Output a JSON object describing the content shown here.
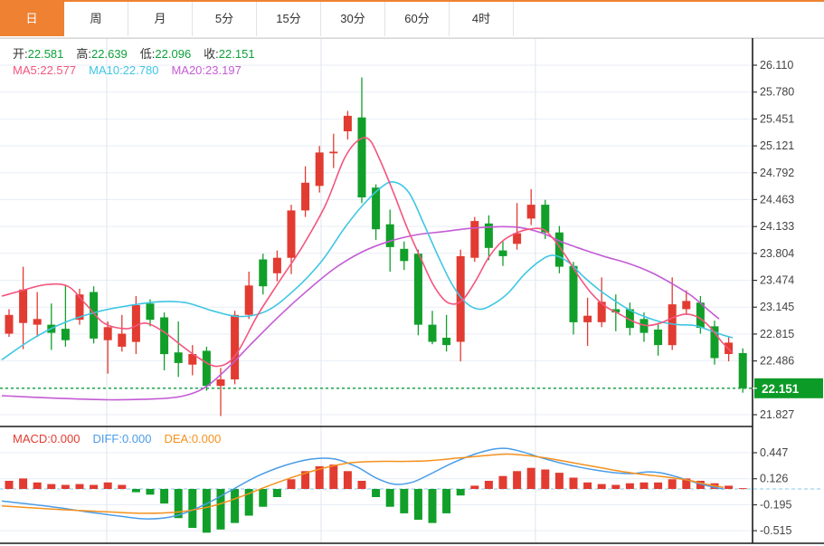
{
  "tabs": {
    "items": [
      {
        "label": "日",
        "selected": true
      },
      {
        "label": "周",
        "selected": false
      },
      {
        "label": "月",
        "selected": false
      },
      {
        "label": "5分",
        "selected": false
      },
      {
        "label": "15分",
        "selected": false
      },
      {
        "label": "30分",
        "selected": false
      },
      {
        "label": "60分",
        "selected": false
      },
      {
        "label": "4时",
        "selected": false
      }
    ]
  },
  "ohlc_bar": {
    "items": [
      {
        "label": "开:",
        "value": "22.581"
      },
      {
        "label": "高:",
        "value": "22.639"
      },
      {
        "label": "低:",
        "value": "22.096"
      },
      {
        "label": "收:",
        "value": "22.151"
      }
    ],
    "value_color": "#0ca13a"
  },
  "ma_bar": {
    "items": [
      {
        "label": "MA5:",
        "value": "22.577",
        "color": "#f4557e"
      },
      {
        "label": "MA10:",
        "value": "22.780",
        "color": "#3fc6e4"
      },
      {
        "label": "MA20:",
        "value": "23.197",
        "color": "#c45bd5"
      }
    ]
  },
  "macd_bar": {
    "items": [
      {
        "label": "MACD:",
        "value": "0.000",
        "color": "#e23b31"
      },
      {
        "label": "DIFF:",
        "value": "0.000",
        "color": "#4a9ce8"
      },
      {
        "label": "DEA:",
        "value": "0.000",
        "color": "#f5911e"
      }
    ]
  },
  "y_axis": {
    "main_ticks": [
      26.11,
      25.78,
      25.451,
      25.121,
      24.792,
      24.463,
      24.133,
      23.804,
      23.474,
      23.145,
      22.815,
      22.486,
      21.827
    ],
    "macd_ticks": [
      0.447,
      0.126,
      -0.195,
      -0.515
    ],
    "price_badge": "22.151"
  },
  "colors": {
    "up": "#e23b31",
    "down": "#119f2a",
    "ma5": "#f4557e",
    "ma10": "#3fc6e4",
    "ma20": "#c45bd5",
    "diff": "#4a9ce8",
    "dea": "#f5911e",
    "grid": "#e8eef5",
    "grid_vertical": "#dde6ef",
    "axis_line": "#1a1a1a",
    "tick_text": "#444444",
    "badge_bg": "#0c9b27",
    "badge_text": "#ffffff",
    "price_dotted": "#0ca13a",
    "zero_dashed": "#9fd3ef",
    "tab_accent": "#ee8132"
  },
  "chart_data": {
    "type": "candlestick",
    "title": "",
    "panes": [
      "price",
      "macd"
    ],
    "main_y_range": [
      21.827,
      26.11
    ],
    "macd_y_range": [
      -0.515,
      0.447
    ],
    "grid": true,
    "price_line_value": 22.151,
    "candles_ohlc": [
      [
        22.82,
        23.12,
        22.78,
        23.05
      ],
      [
        22.95,
        23.64,
        22.63,
        23.36
      ],
      [
        22.93,
        23.33,
        22.78,
        23.0
      ],
      [
        22.93,
        23.19,
        22.62,
        22.83
      ],
      [
        22.88,
        23.42,
        22.66,
        22.74
      ],
      [
        22.99,
        23.37,
        22.93,
        23.3
      ],
      [
        23.33,
        23.4,
        22.7,
        22.76
      ],
      [
        22.74,
        22.97,
        22.33,
        22.9
      ],
      [
        22.66,
        23.05,
        22.6,
        22.82
      ],
      [
        22.72,
        23.28,
        22.57,
        23.17
      ],
      [
        23.19,
        23.24,
        22.91,
        22.99
      ],
      [
        23.02,
        23.08,
        22.37,
        22.57
      ],
      [
        22.59,
        22.97,
        22.29,
        22.46
      ],
      [
        22.44,
        22.68,
        22.31,
        22.57
      ],
      [
        22.61,
        22.66,
        22.12,
        22.18
      ],
      [
        22.18,
        22.4,
        21.81,
        22.26
      ],
      [
        22.26,
        23.1,
        22.2,
        23.05
      ],
      [
        23.05,
        23.58,
        23.0,
        23.41
      ],
      [
        23.73,
        23.8,
        23.3,
        23.4
      ],
      [
        23.56,
        23.84,
        23.46,
        23.75
      ],
      [
        23.75,
        24.4,
        23.55,
        24.33
      ],
      [
        24.33,
        24.87,
        24.25,
        24.67
      ],
      [
        24.63,
        25.12,
        24.55,
        25.04
      ],
      [
        25.03,
        25.27,
        24.85,
        25.05
      ],
      [
        25.3,
        25.55,
        25.2,
        25.49
      ],
      [
        25.47,
        25.96,
        24.42,
        24.49
      ],
      [
        24.61,
        24.65,
        23.97,
        24.1
      ],
      [
        24.16,
        24.34,
        23.58,
        23.88
      ],
      [
        23.86,
        23.95,
        23.6,
        23.71
      ],
      [
        23.8,
        23.85,
        22.8,
        22.93
      ],
      [
        22.93,
        23.1,
        22.69,
        22.72
      ],
      [
        22.77,
        23.05,
        22.6,
        22.68
      ],
      [
        22.72,
        23.85,
        22.48,
        23.77
      ],
      [
        23.75,
        24.25,
        23.7,
        24.2
      ],
      [
        24.17,
        24.27,
        23.72,
        23.87
      ],
      [
        23.84,
        23.95,
        23.65,
        23.77
      ],
      [
        23.92,
        24.42,
        23.85,
        24.05
      ],
      [
        24.23,
        24.59,
        24.15,
        24.4
      ],
      [
        24.4,
        24.46,
        23.98,
        24.06
      ],
      [
        24.06,
        24.14,
        23.56,
        23.64
      ],
      [
        23.65,
        23.7,
        22.81,
        22.96
      ],
      [
        22.96,
        23.26,
        22.67,
        23.04
      ],
      [
        22.96,
        23.51,
        22.9,
        23.21
      ],
      [
        23.12,
        23.3,
        22.85,
        23.08
      ],
      [
        23.12,
        23.2,
        22.8,
        22.89
      ],
      [
        23.0,
        23.08,
        22.72,
        22.83
      ],
      [
        22.87,
        22.95,
        22.55,
        22.68
      ],
      [
        22.68,
        23.51,
        22.62,
        23.18
      ],
      [
        23.12,
        23.35,
        23.05,
        23.22
      ],
      [
        23.2,
        23.28,
        22.82,
        22.89
      ],
      [
        22.91,
        22.98,
        22.44,
        22.52
      ],
      [
        22.57,
        22.78,
        22.48,
        22.71
      ],
      [
        22.581,
        22.639,
        22.096,
        22.151
      ]
    ],
    "ma5_points": [
      [
        2,
        23.28
      ],
      [
        25,
        23.35
      ],
      [
        50,
        23.42
      ],
      [
        75,
        23.4
      ],
      [
        95,
        23.18
      ],
      [
        115,
        22.95
      ],
      [
        140,
        22.88
      ],
      [
        160,
        22.95
      ],
      [
        180,
        22.85
      ],
      [
        200,
        22.68
      ],
      [
        220,
        22.52
      ],
      [
        240,
        22.42
      ],
      [
        260,
        22.55
      ],
      [
        285,
        23.05
      ],
      [
        310,
        23.48
      ],
      [
        335,
        23.9
      ],
      [
        360,
        24.4
      ],
      [
        380,
        24.95
      ],
      [
        395,
        25.18
      ],
      [
        408,
        25.2
      ],
      [
        420,
        24.95
      ],
      [
        435,
        24.55
      ],
      [
        450,
        24.12
      ],
      [
        465,
        23.75
      ],
      [
        480,
        23.4
      ],
      [
        495,
        23.2
      ],
      [
        510,
        23.22
      ],
      [
        525,
        23.45
      ],
      [
        540,
        23.75
      ],
      [
        555,
        23.95
      ],
      [
        570,
        24.05
      ],
      [
        585,
        24.1
      ],
      [
        600,
        24.1
      ],
      [
        612,
        23.98
      ],
      [
        625,
        23.78
      ],
      [
        640,
        23.52
      ],
      [
        655,
        23.3
      ],
      [
        670,
        23.15
      ],
      [
        685,
        23.06
      ],
      [
        700,
        22.97
      ],
      [
        715,
        22.92
      ],
      [
        730,
        22.95
      ],
      [
        745,
        23.02
      ],
      [
        758,
        23.06
      ],
      [
        772,
        23.02
      ],
      [
        785,
        22.9
      ],
      [
        798,
        22.72
      ],
      [
        810,
        22.58
      ]
    ],
    "ma10_points": [
      [
        2,
        22.5
      ],
      [
        35,
        22.75
      ],
      [
        70,
        22.95
      ],
      [
        105,
        23.08
      ],
      [
        140,
        23.16
      ],
      [
        175,
        23.21
      ],
      [
        205,
        23.2
      ],
      [
        235,
        23.1
      ],
      [
        265,
        23.03
      ],
      [
        295,
        23.1
      ],
      [
        325,
        23.35
      ],
      [
        355,
        23.7
      ],
      [
        380,
        24.1
      ],
      [
        400,
        24.38
      ],
      [
        420,
        24.6
      ],
      [
        435,
        24.68
      ],
      [
        452,
        24.55
      ],
      [
        468,
        24.18
      ],
      [
        484,
        23.78
      ],
      [
        500,
        23.42
      ],
      [
        515,
        23.2
      ],
      [
        530,
        23.12
      ],
      [
        545,
        23.18
      ],
      [
        562,
        23.32
      ],
      [
        580,
        23.55
      ],
      [
        598,
        23.72
      ],
      [
        612,
        23.78
      ],
      [
        628,
        23.7
      ],
      [
        645,
        23.52
      ],
      [
        662,
        23.36
      ],
      [
        680,
        23.22
      ],
      [
        698,
        23.1
      ],
      [
        715,
        23.02
      ],
      [
        732,
        22.96
      ],
      [
        750,
        22.93
      ],
      [
        768,
        22.92
      ],
      [
        785,
        22.86
      ],
      [
        800,
        22.8
      ],
      [
        810,
        22.77
      ]
    ],
    "ma20_points": [
      [
        2,
        22.06
      ],
      [
        60,
        22.03
      ],
      [
        120,
        22.01
      ],
      [
        170,
        22.02
      ],
      [
        200,
        22.05
      ],
      [
        225,
        22.15
      ],
      [
        250,
        22.38
      ],
      [
        280,
        22.72
      ],
      [
        310,
        23.05
      ],
      [
        340,
        23.35
      ],
      [
        370,
        23.62
      ],
      [
        400,
        23.82
      ],
      [
        430,
        23.95
      ],
      [
        460,
        24.03
      ],
      [
        490,
        24.07
      ],
      [
        520,
        24.11
      ],
      [
        550,
        24.13
      ],
      [
        575,
        24.12
      ],
      [
        600,
        24.05
      ],
      [
        620,
        23.95
      ],
      [
        645,
        23.85
      ],
      [
        670,
        23.76
      ],
      [
        695,
        23.68
      ],
      [
        720,
        23.57
      ],
      [
        745,
        23.42
      ],
      [
        765,
        23.28
      ],
      [
        782,
        23.12
      ],
      [
        795,
        23.0
      ]
    ],
    "macd_hist": [
      0.1,
      0.13,
      0.08,
      0.06,
      0.05,
      0.06,
      0.05,
      0.08,
      0.05,
      -0.04,
      -0.07,
      -0.18,
      -0.36,
      -0.48,
      -0.54,
      -0.5,
      -0.42,
      -0.33,
      -0.22,
      -0.1,
      0.12,
      0.22,
      0.28,
      0.3,
      0.22,
      0.1,
      -0.1,
      -0.22,
      -0.3,
      -0.38,
      -0.42,
      -0.3,
      -0.08,
      0.04,
      0.1,
      0.16,
      0.22,
      0.26,
      0.24,
      0.2,
      0.14,
      0.08,
      0.06,
      0.05,
      0.07,
      0.08,
      0.08,
      0.12,
      0.13,
      0.1,
      0.07,
      0.04,
      0.01
    ],
    "diff_points": [
      [
        2,
        -0.15
      ],
      [
        50,
        -0.21
      ],
      [
        95,
        -0.28
      ],
      [
        135,
        -0.34
      ],
      [
        165,
        -0.37
      ],
      [
        195,
        -0.33
      ],
      [
        225,
        -0.2
      ],
      [
        255,
        -0.02
      ],
      [
        285,
        0.16
      ],
      [
        315,
        0.29
      ],
      [
        345,
        0.37
      ],
      [
        370,
        0.37
      ],
      [
        395,
        0.27
      ],
      [
        415,
        0.14
      ],
      [
        435,
        0.06
      ],
      [
        455,
        0.08
      ],
      [
        475,
        0.18
      ],
      [
        500,
        0.32
      ],
      [
        525,
        0.43
      ],
      [
        545,
        0.49
      ],
      [
        560,
        0.5
      ],
      [
        580,
        0.45
      ],
      [
        600,
        0.38
      ],
      [
        620,
        0.32
      ],
      [
        640,
        0.27
      ],
      [
        660,
        0.23
      ],
      [
        680,
        0.2
      ],
      [
        700,
        0.19
      ],
      [
        715,
        0.21
      ],
      [
        730,
        0.2
      ],
      [
        745,
        0.16
      ],
      [
        760,
        0.11
      ],
      [
        775,
        0.06
      ],
      [
        790,
        0.02
      ],
      [
        800,
        0.0
      ]
    ],
    "dea_points": [
      [
        2,
        -0.21
      ],
      [
        60,
        -0.25
      ],
      [
        115,
        -0.28
      ],
      [
        160,
        -0.3
      ],
      [
        200,
        -0.28
      ],
      [
        235,
        -0.21
      ],
      [
        265,
        -0.1
      ],
      [
        295,
        0.03
      ],
      [
        325,
        0.15
      ],
      [
        355,
        0.25
      ],
      [
        385,
        0.32
      ],
      [
        415,
        0.34
      ],
      [
        445,
        0.34
      ],
      [
        475,
        0.35
      ],
      [
        505,
        0.38
      ],
      [
        535,
        0.41
      ],
      [
        560,
        0.43
      ],
      [
        585,
        0.41
      ],
      [
        610,
        0.37
      ],
      [
        635,
        0.32
      ],
      [
        660,
        0.27
      ],
      [
        685,
        0.22
      ],
      [
        710,
        0.18
      ],
      [
        735,
        0.15
      ],
      [
        760,
        0.11
      ],
      [
        780,
        0.06
      ],
      [
        800,
        0.02
      ]
    ]
  }
}
